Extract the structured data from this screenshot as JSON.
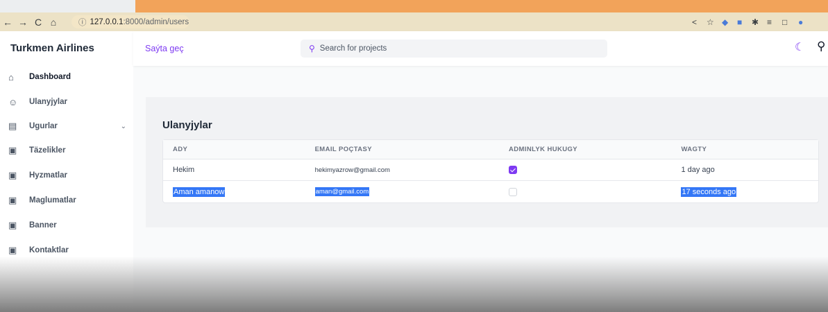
{
  "browser": {
    "url_host": "127.0.0.1",
    "url_path": ":8000/admin/users",
    "back_icon": "back-arrow-icon",
    "forward_icon": "forward-arrow-icon"
  },
  "sidebar": {
    "brand": "Turkmen Airlines",
    "items": [
      {
        "label": "Dashboard",
        "icon": "home-icon"
      },
      {
        "label": "Ulanyjylar",
        "icon": "users-icon"
      },
      {
        "label": "Ugurlar",
        "icon": "cards-icon",
        "expandable": true
      },
      {
        "label": "Täzelikler",
        "icon": "clipboard-icon"
      },
      {
        "label": "Hyzmatlar",
        "icon": "clipboard-icon"
      },
      {
        "label": "Maglumatlar",
        "icon": "clipboard-icon"
      },
      {
        "label": "Banner",
        "icon": "clipboard-icon"
      },
      {
        "label": "Kontaktlar",
        "icon": "clipboard-icon"
      }
    ]
  },
  "header": {
    "site_link": "Saýta geç",
    "search_placeholder": "Search for projects",
    "accent_color": "#7e3af2"
  },
  "main": {
    "title": "Ulanyjylar",
    "table": {
      "columns": [
        "ADY",
        "EMAIL POÇTASY",
        "ADMINLYK HUKUGY",
        "WAGTY"
      ],
      "rows": [
        {
          "name": "Hekim",
          "email": "hekimyazrow@gmail.com",
          "admin": true,
          "time": "1 day ago",
          "selected": false
        },
        {
          "name": "Aman amanow",
          "email": "aman@gmail.com",
          "admin": false,
          "time": "17 seconds ago",
          "selected": true
        }
      ]
    }
  }
}
